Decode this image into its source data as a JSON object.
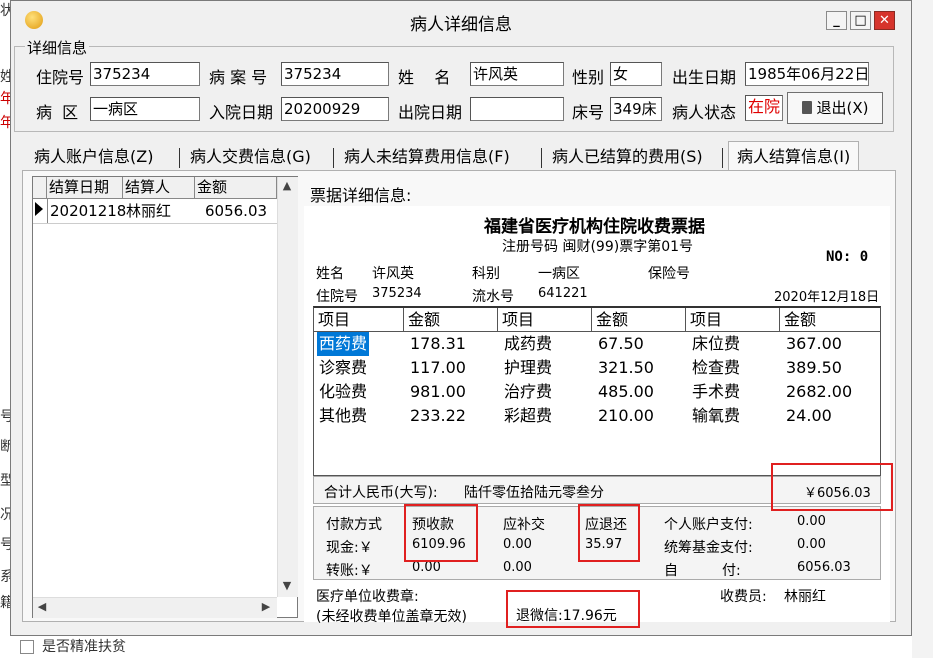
{
  "background": {
    "left_fragments": [
      "状",
      "姓",
      "年",
      "年",
      "号",
      "断",
      "型",
      "况",
      "号",
      "系",
      "籍"
    ],
    "bottom_label": "是否精准扶贫"
  },
  "window": {
    "title": "病人详细信息",
    "btn_minimize": "_",
    "btn_maximize": "□",
    "btn_close": "✕"
  },
  "details": {
    "legend": "详细信息",
    "admission_no_label": "住院号",
    "admission_no": "375234",
    "case_no_label": "病 案 号",
    "case_no": "375234",
    "name_label": "姓    名",
    "name": "许风英",
    "gender_label": "性别",
    "gender": "女",
    "birth_label": "出生日期",
    "birth": "1985年06月22日",
    "ward_label": "病  区",
    "ward": "一病区",
    "admit_date_label": "入院日期",
    "admit_date": "20200929",
    "discharge_label": "出院日期",
    "discharge": "",
    "bed_label": "床号",
    "bed": "349床",
    "status_label": "病人状态",
    "status": "在院",
    "exit_button": "退出(X)"
  },
  "tabs": [
    {
      "label": "病人账户信息(Z)"
    },
    {
      "label": "病人交费信息(G)"
    },
    {
      "label": "病人未结算费用信息(F)"
    },
    {
      "label": "病人已结算的费用(S)"
    },
    {
      "label": "病人结算信息(I)"
    }
  ],
  "settlement_grid": {
    "columns": [
      "结算日期",
      "结算人",
      "金额"
    ],
    "rows": [
      {
        "date": "20201218",
        "person": "林丽红",
        "amount": "6056.03"
      }
    ]
  },
  "receipt": {
    "section_label": "票据详细信息:",
    "title": "福建省医疗机构住院收费票据",
    "reg_code": "注册号码 闽财(99)票字第01号",
    "no_label": "NO: 0",
    "name_label": "姓名",
    "name": "许风英",
    "dept_label": "科别",
    "dept": "一病区",
    "insurance_label": "保险号",
    "admission_label": "住院号",
    "admission": "375234",
    "serial_label": "流水号",
    "serial": "641221",
    "date": "2020年12月18日",
    "fee_headers": [
      "项目",
      "金额",
      "项目",
      "金额",
      "项目",
      "金额"
    ],
    "fees": [
      [
        {
          "item": "西药费",
          "amount": "178.31"
        },
        {
          "item": "成药费",
          "amount": "67.50"
        },
        {
          "item": "床位费",
          "amount": "367.00"
        }
      ],
      [
        {
          "item": "诊察费",
          "amount": "117.00"
        },
        {
          "item": "护理费",
          "amount": "321.50"
        },
        {
          "item": "检查费",
          "amount": "389.50"
        }
      ],
      [
        {
          "item": "化验费",
          "amount": "981.00"
        },
        {
          "item": "治疗费",
          "amount": "485.00"
        },
        {
          "item": "手术费",
          "amount": "2682.00"
        }
      ],
      [
        {
          "item": "其他费",
          "amount": "233.22"
        },
        {
          "item": "彩超费",
          "amount": "210.00"
        },
        {
          "item": "输氧费",
          "amount": "24.00"
        }
      ]
    ],
    "total_label": "合计人民币(大写):",
    "total_words": "陆仟零伍拾陆元零叁分",
    "total_amount": "￥6056.03",
    "pay_method_label": "付款方式",
    "prepaid_label": "预收款",
    "supplement_label": "应补交",
    "refund_label": "应退还",
    "personal_label": "个人账户支付:",
    "cash_label": "现金:￥",
    "prepaid_cash": "6109.96",
    "supplement_cash": "0.00",
    "refund_cash": "35.97",
    "fund_label": "统筹基金支付:",
    "transfer_label": "转账:￥",
    "transfer_prepaid": "0.00",
    "transfer_supplement": "0.00",
    "self_label_a": "自",
    "self_label_b": "付:",
    "personal_value": "0.00",
    "fund_value": "0.00",
    "self_value": "6056.03",
    "stamp_label": "医疗单位收费章:",
    "stamp_note": "(未经收费单位盖章无效)",
    "wechat_refund": "退微信:17.96元",
    "cashier_label": "收费员:",
    "cashier": "林丽红"
  },
  "colors": {
    "highlight": "#e02020",
    "selection": "#0078d7",
    "status": "#e00000"
  }
}
